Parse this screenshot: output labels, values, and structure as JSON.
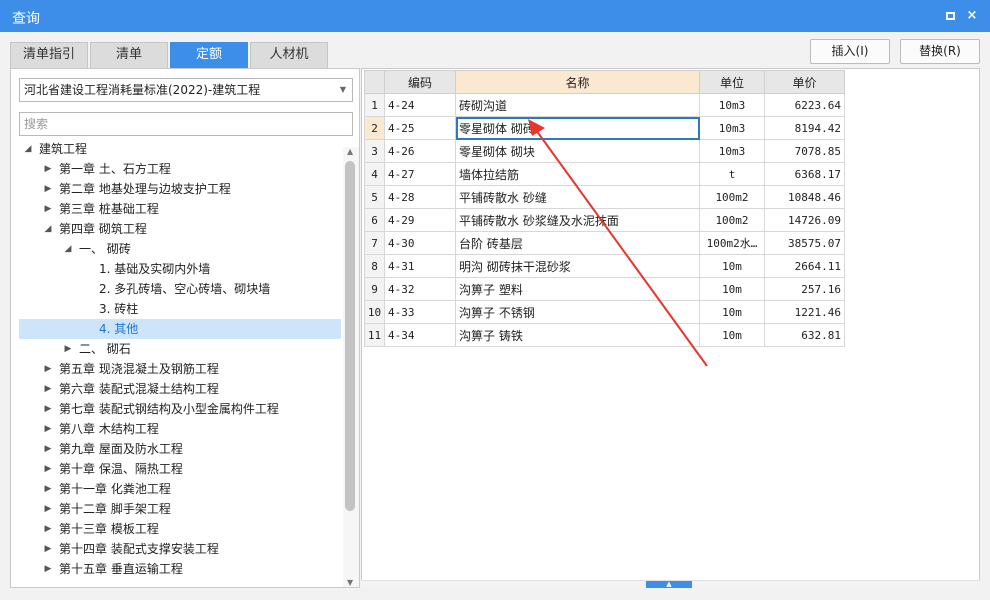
{
  "window": {
    "title": "查询",
    "maximize_icon": "maximize-icon",
    "close_icon": "close-icon",
    "close_glyph": "×"
  },
  "tabs": [
    {
      "label": "清单指引",
      "active": false
    },
    {
      "label": "清单",
      "active": false
    },
    {
      "label": "定额",
      "active": true
    },
    {
      "label": "人材机",
      "active": false
    }
  ],
  "actions": {
    "insert_label": "插入(I)",
    "replace_label": "替换(R)"
  },
  "left": {
    "standard_selected": "河北省建设工程消耗量标准(2022)-建筑工程",
    "dropdown_icon": "chevron-down-icon",
    "search_placeholder": "搜索",
    "search_value": ""
  },
  "tree": [
    {
      "label": "建筑工程",
      "expanded": true
    },
    {
      "label": "第一章 土、石方工程",
      "expanded": false
    },
    {
      "label": "第二章 地基处理与边坡支护工程",
      "expanded": false
    },
    {
      "label": "第三章 桩基础工程",
      "expanded": false
    },
    {
      "label": "第四章 砌筑工程",
      "expanded": true
    },
    {
      "label": "一、 砌砖",
      "expanded": true
    },
    {
      "label": "1. 基础及实砌内外墙",
      "expanded": null
    },
    {
      "label": "2. 多孔砖墙、空心砖墙、砌块墙",
      "expanded": null
    },
    {
      "label": "3. 砖柱",
      "expanded": null
    },
    {
      "label": "4. 其他",
      "expanded": null,
      "selected": true
    },
    {
      "label": "二、 砌石",
      "expanded": false
    },
    {
      "label": "第五章 现浇混凝土及钢筋工程",
      "expanded": false
    },
    {
      "label": "第六章 装配式混凝土结构工程",
      "expanded": false
    },
    {
      "label": "第七章 装配式钢结构及小型金属构件工程",
      "expanded": false
    },
    {
      "label": "第八章 木结构工程",
      "expanded": false
    },
    {
      "label": "第九章 屋面及防水工程",
      "expanded": false
    },
    {
      "label": "第十章 保温、隔热工程",
      "expanded": false
    },
    {
      "label": "第十一章 化粪池工程",
      "expanded": false
    },
    {
      "label": "第十二章 脚手架工程",
      "expanded": false
    },
    {
      "label": "第十三章 模板工程",
      "expanded": false
    },
    {
      "label": "第十四章 装配式支撑安装工程",
      "expanded": false
    },
    {
      "label": "第十五章 垂直运输工程",
      "expanded": false
    }
  ],
  "grid": {
    "columns": {
      "code": "编码",
      "name": "名称",
      "unit": "单位",
      "price": "单价"
    },
    "rows": [
      {
        "no": "1",
        "code": "4-24",
        "name": "砖砌沟道",
        "unit": "10m3",
        "price": "6223.64"
      },
      {
        "no": "2",
        "code": "4-25",
        "name": "零星砌体 砌砖",
        "unit": "10m3",
        "price": "8194.42",
        "selected": true
      },
      {
        "no": "3",
        "code": "4-26",
        "name": "零星砌体 砌块",
        "unit": "10m3",
        "price": "7078.85"
      },
      {
        "no": "4",
        "code": "4-27",
        "name": "墙体拉结筋",
        "unit": "t",
        "price": "6368.17"
      },
      {
        "no": "5",
        "code": "4-28",
        "name": "平铺砖散水 砂缝",
        "unit": "100m2",
        "price": "10848.46"
      },
      {
        "no": "6",
        "code": "4-29",
        "name": "平铺砖散水 砂浆缝及水泥抹面",
        "unit": "100m2",
        "price": "14726.09"
      },
      {
        "no": "7",
        "code": "4-30",
        "name": "台阶 砖基层",
        "unit": "100m2水…",
        "price": "38575.07"
      },
      {
        "no": "8",
        "code": "4-31",
        "name": "明沟 砌砖抹干混砂浆",
        "unit": "10m",
        "price": "2664.11"
      },
      {
        "no": "9",
        "code": "4-32",
        "name": "沟箅子 塑料",
        "unit": "10m",
        "price": "257.16"
      },
      {
        "no": "10",
        "code": "4-33",
        "name": "沟箅子 不锈钢",
        "unit": "10m",
        "price": "1221.46"
      },
      {
        "no": "11",
        "code": "4-34",
        "name": "沟箅子 铸铁",
        "unit": "10m",
        "price": "632.81"
      }
    ]
  },
  "colors": {
    "accent": "#3c8ee8",
    "selection": "#cde4fa",
    "header_highlight": "#fbe8d1",
    "annotation_arrow": "#e8352e"
  }
}
